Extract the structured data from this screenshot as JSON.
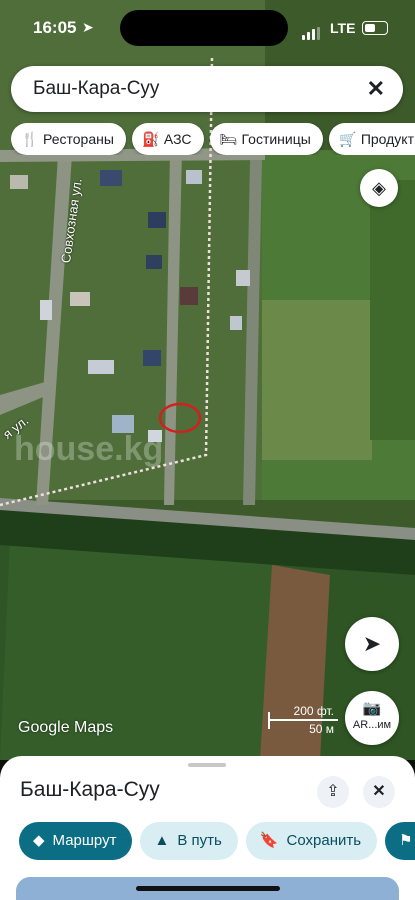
{
  "status_bar": {
    "time": "16:05",
    "network": "LTE",
    "battery_fraction": 0.55
  },
  "search": {
    "query": "Баш-Кара-Суу"
  },
  "categories": [
    {
      "icon": "restaurant-icon",
      "label": "Рестораны"
    },
    {
      "icon": "gas-station-icon",
      "label": "АЗС"
    },
    {
      "icon": "hotel-icon",
      "label": "Гостиницы"
    },
    {
      "icon": "cart-icon",
      "label": "Продукты"
    }
  ],
  "map": {
    "streets": [
      "Совхозная ул.",
      "я ул."
    ],
    "watermark": "house.kg",
    "attribution": "Google Maps",
    "scale": {
      "imperial": "200 фт.",
      "metric": "50 м"
    },
    "ar_label": "AR...им"
  },
  "place_sheet": {
    "title": "Баш-Кара-Суу",
    "actions": [
      {
        "name": "route",
        "label": "Маршрут",
        "primary": true
      },
      {
        "name": "start",
        "label": "В путь",
        "primary": false
      },
      {
        "name": "save",
        "label": "Сохранить",
        "primary": false
      }
    ]
  },
  "colors": {
    "accent": "#0b6e85",
    "chip_bg": "#ffffff",
    "secondary_button_bg": "#d8eef3"
  }
}
